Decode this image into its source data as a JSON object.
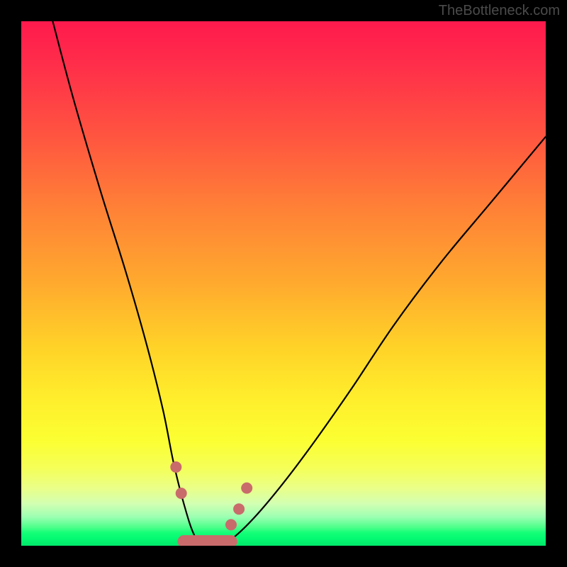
{
  "watermark": "TheBottleneck.com",
  "chart_data": {
    "type": "line",
    "title": "",
    "xlabel": "",
    "ylabel": "",
    "xlim": [
      0,
      100
    ],
    "ylim": [
      0,
      100
    ],
    "series": [
      {
        "name": "bottleneck-curve",
        "x": [
          6,
          10,
          15,
          20,
          24,
          27,
          29,
          31,
          33,
          35,
          38,
          41,
          45,
          50,
          56,
          63,
          71,
          80,
          90,
          100
        ],
        "y": [
          100,
          85,
          68,
          52,
          38,
          26,
          16,
          8,
          2,
          0,
          0,
          2,
          6,
          12,
          20,
          30,
          42,
          54,
          66,
          78
        ]
      }
    ],
    "markers": {
      "name": "curve-dots",
      "color": "#c96b6b",
      "points": [
        {
          "x": 29.5,
          "y": 15
        },
        {
          "x": 30.5,
          "y": 10
        },
        {
          "x": 40.0,
          "y": 4
        },
        {
          "x": 41.5,
          "y": 7
        },
        {
          "x": 43.0,
          "y": 11
        }
      ]
    },
    "minimum_band": {
      "name": "min-segment",
      "color": "#c96b6b",
      "x_range": [
        31,
        40
      ],
      "y": 0,
      "thickness_pct": 2.4
    },
    "notes": "V-shaped curve on a red-to-green vertical gradient. Left branch descends steeply from upper-left; right branch rises less steeply toward upper-right. Minimum near x≈33–40% marked with a thick salmon segment and a few salmon dots along the curve near the trough. No visible axes, ticks, or labels; values estimated from pixel positions as percentages of the plot area."
  }
}
